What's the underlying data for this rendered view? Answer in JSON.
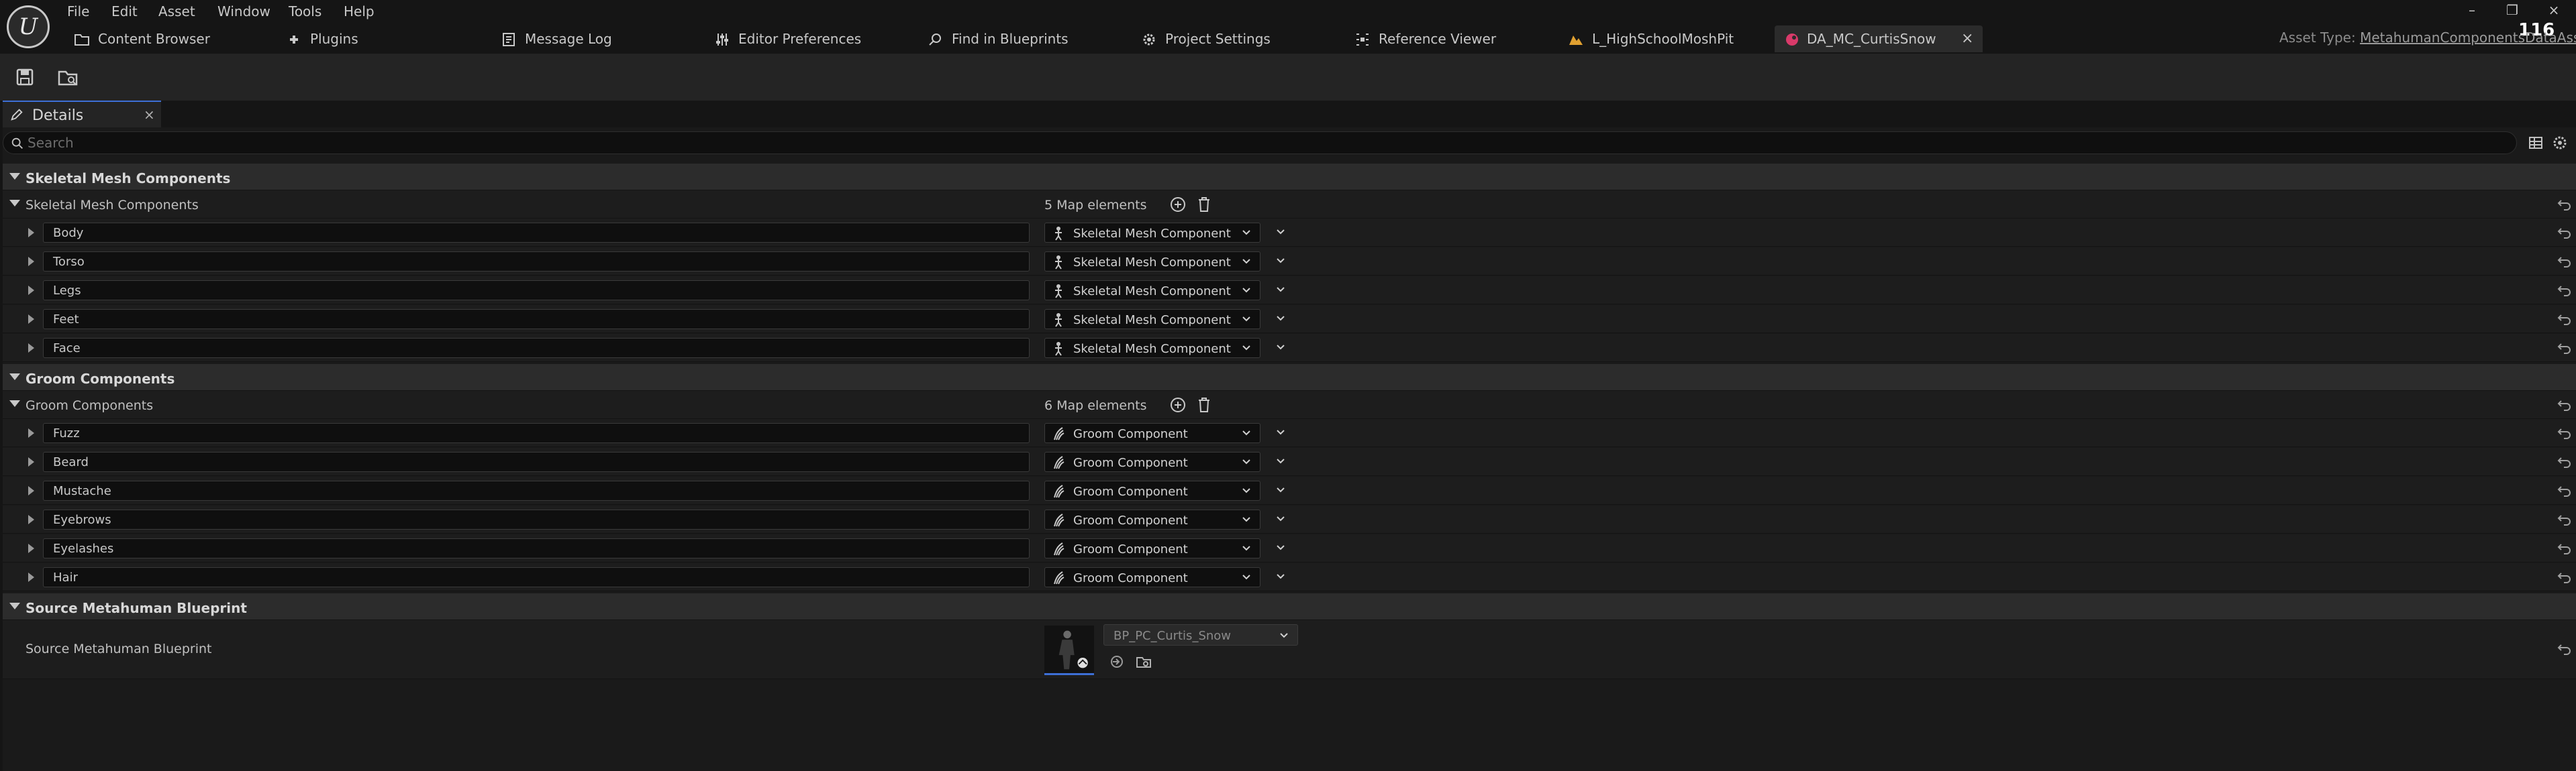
{
  "menu": [
    "File",
    "Edit",
    "Asset",
    "Window",
    "Tools",
    "Help"
  ],
  "tabs": [
    {
      "label": "Content Browser",
      "icon": "folder-icon"
    },
    {
      "label": "Plugins",
      "icon": "plugin-icon"
    },
    {
      "label": "Message Log",
      "icon": "message-log-icon"
    },
    {
      "label": "Editor Preferences",
      "icon": "sliders-icon"
    },
    {
      "label": "Find in Blueprints",
      "icon": "find-icon"
    },
    {
      "label": "Project Settings",
      "icon": "gear-icon"
    },
    {
      "label": "Reference Viewer",
      "icon": "reference-viewer-icon"
    },
    {
      "label": "L_HighSchoolMoshPit",
      "icon": "level-icon"
    },
    {
      "label": "DA_MC_CurtisSnow",
      "icon": "data-asset-icon",
      "active": true
    }
  ],
  "fps": "116",
  "asset_type": {
    "label": "Asset Type:",
    "value": "MetahumanComponentsDataAsset"
  },
  "toolbar": [
    "save-icon",
    "browse-to-asset-icon"
  ],
  "details": {
    "tab_label": "Details",
    "close": "×",
    "search_placeholder": "Search"
  },
  "sections": {
    "skeletal": {
      "category": "Skeletal Mesh Components",
      "header": "Skeletal Mesh Components",
      "count": "5 Map elements",
      "value_label": "Skeletal Mesh Component",
      "keys": [
        "Body",
        "Torso",
        "Legs",
        "Feet",
        "Face"
      ]
    },
    "groom": {
      "category": "Groom Components",
      "header": "Groom Components",
      "count": "6 Map elements",
      "value_label": "Groom Component",
      "keys": [
        "Fuzz",
        "Beard",
        "Mustache",
        "Eyebrows",
        "Eyelashes",
        "Hair"
      ]
    },
    "source": {
      "category": "Source Metahuman Blueprint",
      "label": "Source Metahuman Blueprint",
      "value": "BP_PC_Curtis_Snow"
    }
  },
  "colors": {
    "accent": "#3d6fd6",
    "background": "#151515",
    "panel": "#1d1d1d",
    "category": "#2c2c2c"
  }
}
